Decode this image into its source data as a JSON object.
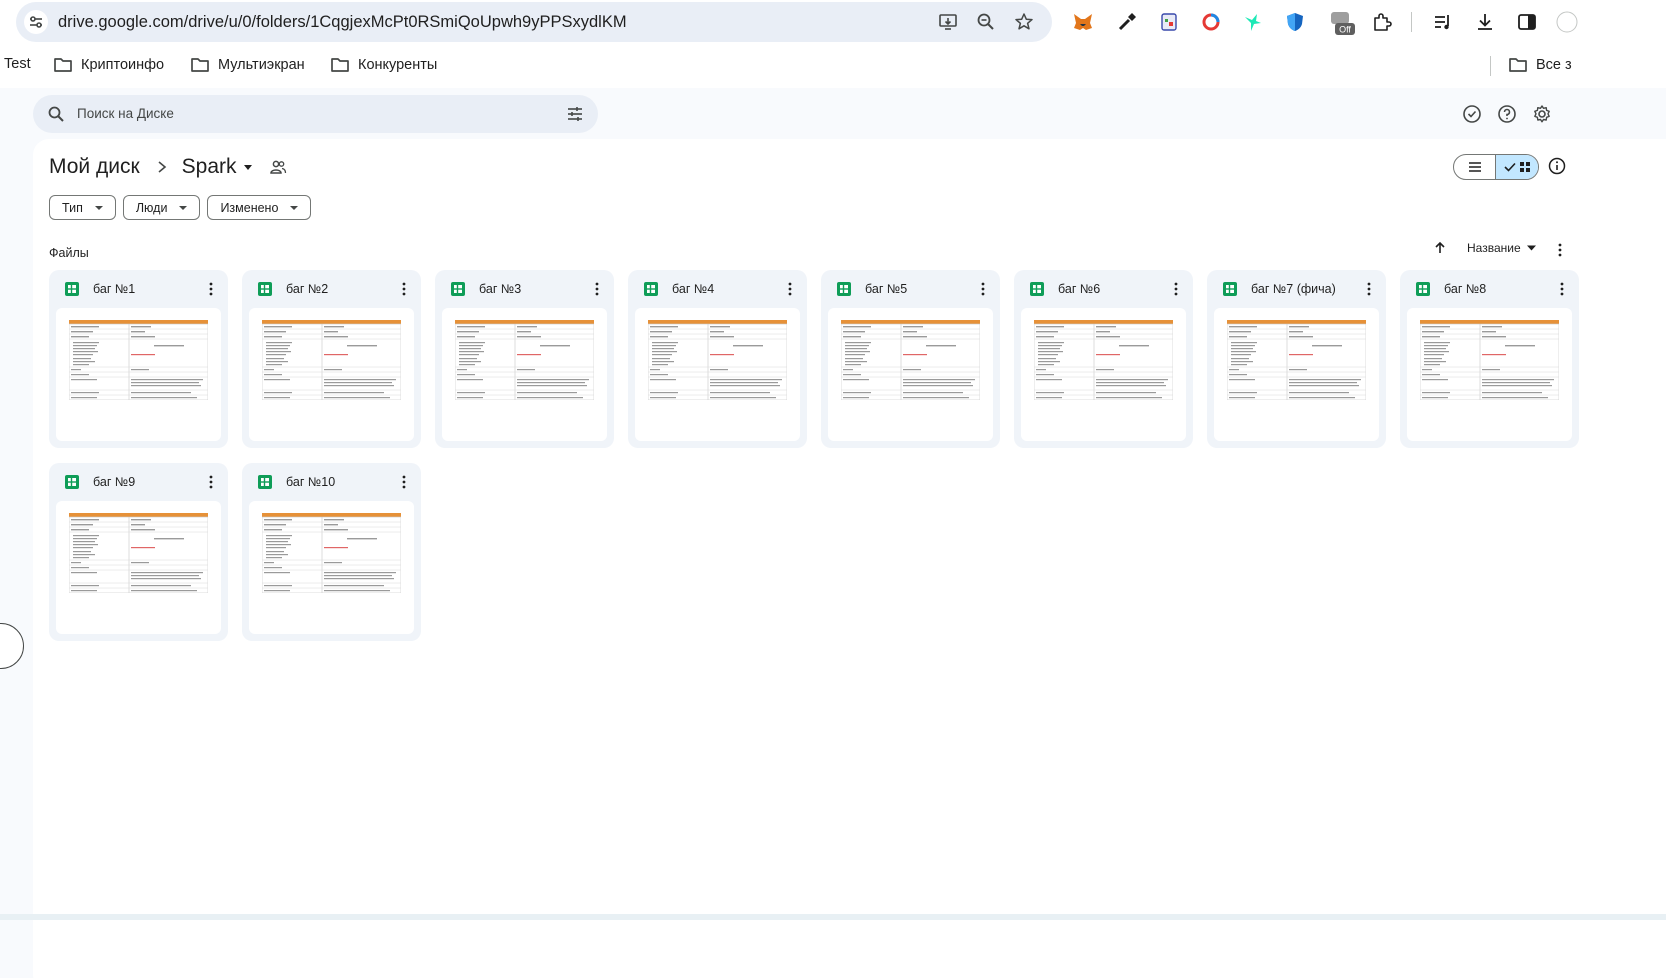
{
  "browser": {
    "url": "drive.google.com/drive/u/0/folders/1CqgjexMcPt0RSmiQoUpwh9yPPSxydlKM",
    "extension_badge": "Off",
    "bookmarks": [
      "Test",
      "Криптоинфо",
      "Мультиэкран",
      "Конкуренты"
    ],
    "bookmarks_right": "Все з"
  },
  "search": {
    "placeholder": "Поиск на Диске"
  },
  "breadcrumb": {
    "root": "Мой диск",
    "current": "Spark"
  },
  "filters": [
    "Тип",
    "Люди",
    "Изменено"
  ],
  "section": {
    "files_label": "Файлы",
    "sort_label": "Название"
  },
  "files": [
    {
      "name": "баг №1"
    },
    {
      "name": "баг №2"
    },
    {
      "name": "баг №3"
    },
    {
      "name": "баг №4"
    },
    {
      "name": "баг №5"
    },
    {
      "name": "баг №6"
    },
    {
      "name": "баг №7 (фича)"
    },
    {
      "name": "баг №8"
    },
    {
      "name": "баг №9"
    },
    {
      "name": "баг №10"
    }
  ],
  "colors": {
    "sheets_green": "#0f9d58",
    "selected_view": "#c2e7ff",
    "thumb_header": "#e69138"
  }
}
